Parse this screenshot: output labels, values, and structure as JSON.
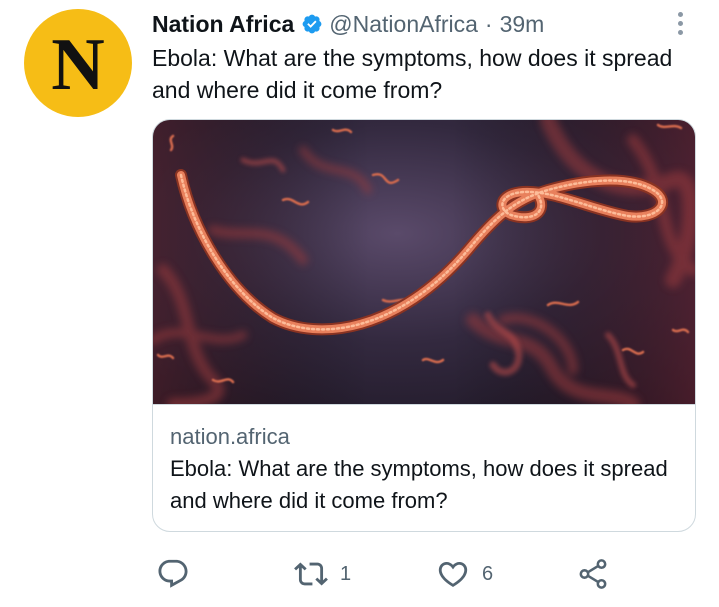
{
  "tweet": {
    "avatar_letter": "N",
    "avatar_color": "#f6bd16",
    "display_name": "Nation Africa",
    "handle": "@NationAfrica",
    "separator": "·",
    "time": "39m",
    "text": "Ebola: What are the symptoms, how does it spread and where did it come from?",
    "verified_badge_color": "#1d9bf0"
  },
  "card": {
    "image_subject": "ebola-virus-illustration",
    "domain": "nation.africa",
    "title": "Ebola: What are the symptoms, how does it spread and where did it come from?"
  },
  "actions": {
    "reply_icon": "reply-icon",
    "retweet_icon": "retweet-icon",
    "retweet_count": "1",
    "like_icon": "heart-icon",
    "like_count": "6",
    "share_icon": "share-icon"
  },
  "colors": {
    "text_primary": "#0f1419",
    "text_secondary": "#536471",
    "border": "#cfd9de"
  }
}
